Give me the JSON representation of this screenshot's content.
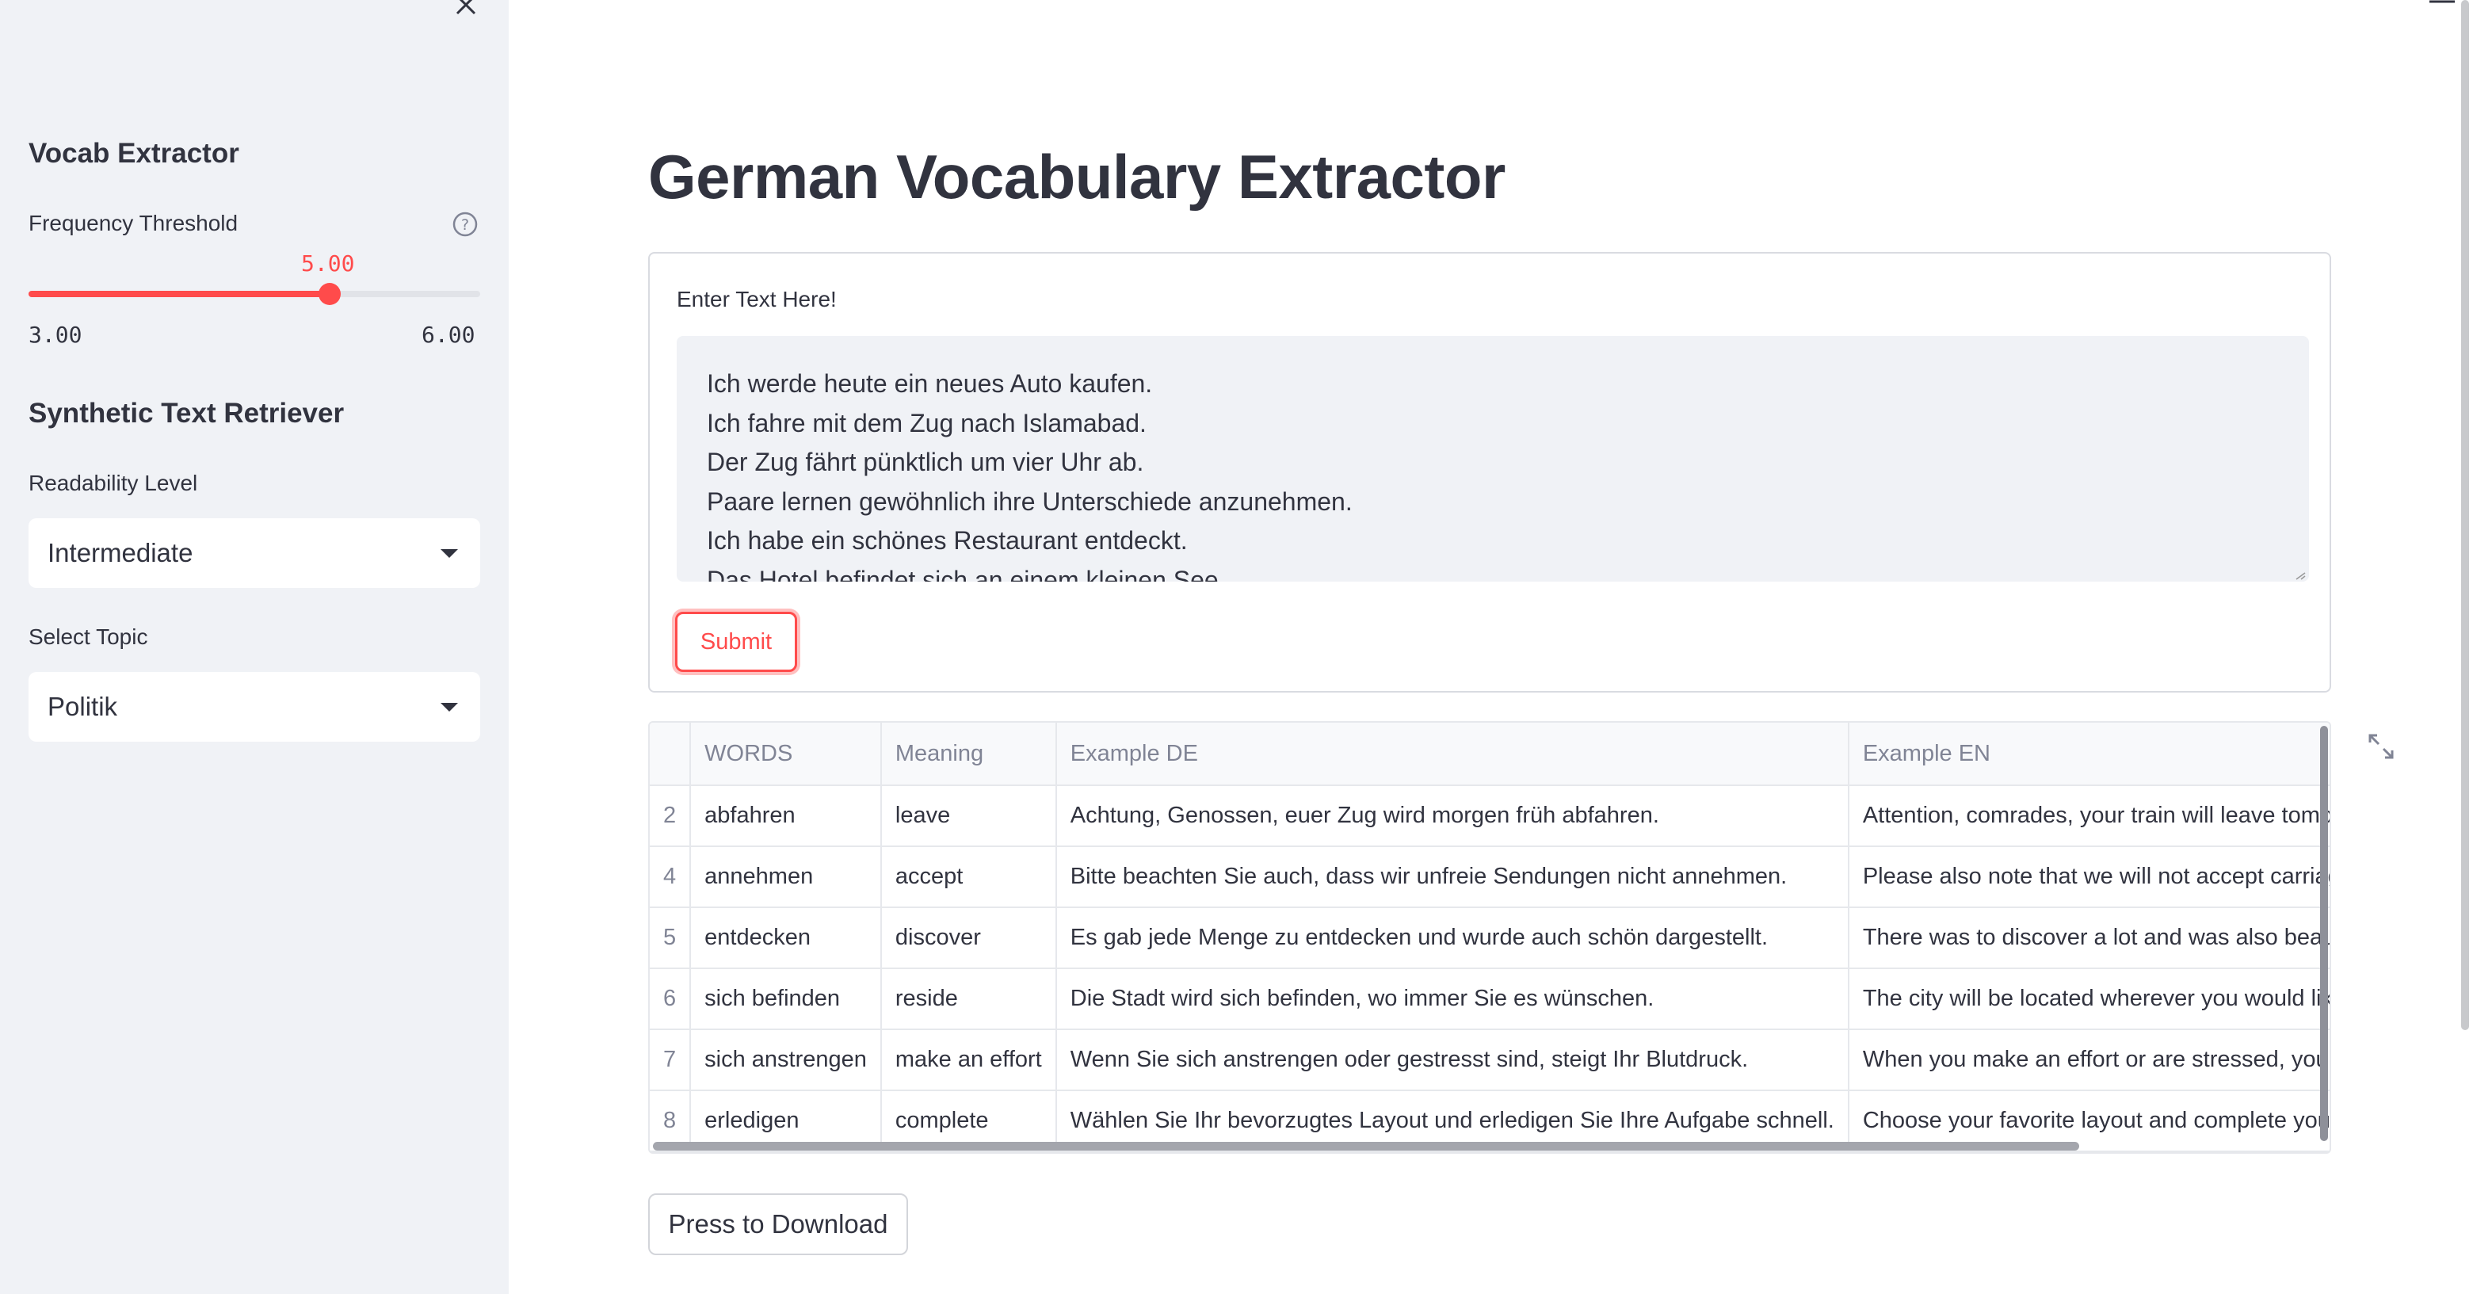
{
  "sidebar": {
    "vocab_heading": "Vocab Extractor",
    "frequency_label": "Frequency Threshold",
    "slider": {
      "value": 5.0,
      "value_text": "5.00",
      "min_text": "3.00",
      "max_text": "6.00",
      "min": 3.0,
      "max": 6.0
    },
    "synthetic_heading": "Synthetic Text Retriever",
    "readability_label": "Readability Level",
    "readability_value": "Intermediate",
    "topic_label": "Select Topic",
    "topic_value": "Politik"
  },
  "main": {
    "title": "German Vocabulary Extractor",
    "form": {
      "label": "Enter Text Here!",
      "text_lines": [
        "Ich werde heute ein neues Auto kaufen.",
        "Ich fahre mit dem Zug nach Islamabad.",
        "Der Zug fährt pünktlich um vier Uhr ab.",
        "Paare lernen gewöhnlich ihre Unterschiede anzunehmen.",
        "Ich habe ein schönes Restaurant entdeckt.",
        "Das Hotel befindet sich an einem kleinen See."
      ],
      "submit_label": "Submit"
    },
    "table": {
      "columns": [
        "",
        "WORDS",
        "Meaning",
        "Example DE",
        "Example EN"
      ],
      "rows": [
        [
          "2",
          "abfahren",
          "leave",
          "Achtung, Genossen, euer Zug wird morgen früh abfahren.",
          "Attention, comrades, your train will leave tomorrow morning."
        ],
        [
          "4",
          "annehmen",
          "accept",
          "Bitte beachten Sie auch, dass wir unfreie Sendungen nicht annehmen.",
          "Please also note that we will not accept carriage-forward shipments."
        ],
        [
          "5",
          "entdecken",
          "discover",
          "Es gab jede Menge zu entdecken und wurde auch schön dargestellt.",
          "There was to discover a lot and was also beautifully presented."
        ],
        [
          "6",
          "sich befinden",
          "reside",
          "Die Stadt wird sich befinden, wo immer Sie es wünschen.",
          "The city will be located wherever you would like it."
        ],
        [
          "7",
          "sich anstrengen",
          "make an effort",
          "Wenn Sie sich anstrengen oder gestresst sind, steigt Ihr Blutdruck.",
          "When you make an effort or are stressed, your blood pressure rises."
        ],
        [
          "8",
          "erledigen",
          "complete",
          "Wählen Sie Ihr bevorzugtes Layout und erledigen Sie Ihre Aufgabe schnell.",
          "Choose your favorite layout and complete your task quickly."
        ]
      ]
    },
    "download_label": "Press to Download"
  },
  "colors": {
    "accent": "#ff4b4b",
    "sidebar_bg": "#f0f2f6",
    "text": "#31333f"
  }
}
